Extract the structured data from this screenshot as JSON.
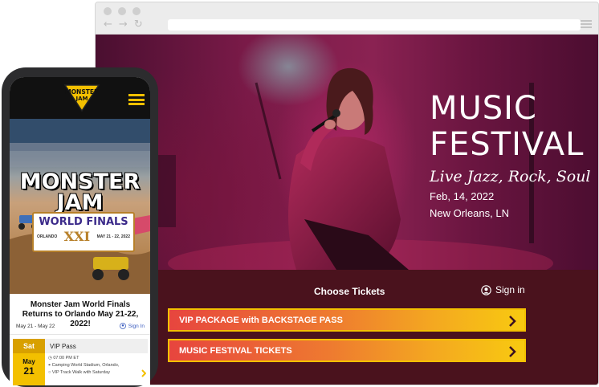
{
  "desktop": {
    "hero": {
      "title_line1": "MUSIC",
      "title_line2": "FESTIVAL",
      "subtitle": "Live Jazz, Rock, Soul",
      "date": "Feb, 14, 2022",
      "location": "New Orleans, LN"
    },
    "tickets": {
      "heading": "Choose Tickets",
      "sign_in": "Sign in",
      "options": [
        {
          "label": "VIP PACKAGE with BACKSTAGE PASS"
        },
        {
          "label": "MUSIC FESTIVAL TICKETS"
        }
      ]
    }
  },
  "mobile": {
    "logo_text_1": "MONSTER",
    "logo_text_2": "JAM",
    "banner": {
      "title_line1": "MONSTER",
      "title_line2": "JAM",
      "world_finals": "WORLD FINALS",
      "city": "ORLANDO",
      "numeral": "XXI",
      "dates": "MAY 21 - 22, 2022"
    },
    "headline": "Monster Jam World Finals Returns to Orlando May 21-22, 2022!",
    "date_range": "May 21 - May 22",
    "sign_in": "Sign In",
    "event": {
      "day": "Sat",
      "pass": "VIP Pass",
      "month": "May",
      "daynum": "21",
      "time": "07:00 PM ET",
      "venue": "Camping World Stadium, Orlando,",
      "perk": "VIP Track Walk with Saturday"
    }
  },
  "colors": {
    "ticket_gradient_start": "#e7453e",
    "ticket_gradient_end": "#f8ca10",
    "ticket_border": "#f3c000",
    "tickets_bg": "#4a121d",
    "mobile_accent": "#f3c000"
  }
}
